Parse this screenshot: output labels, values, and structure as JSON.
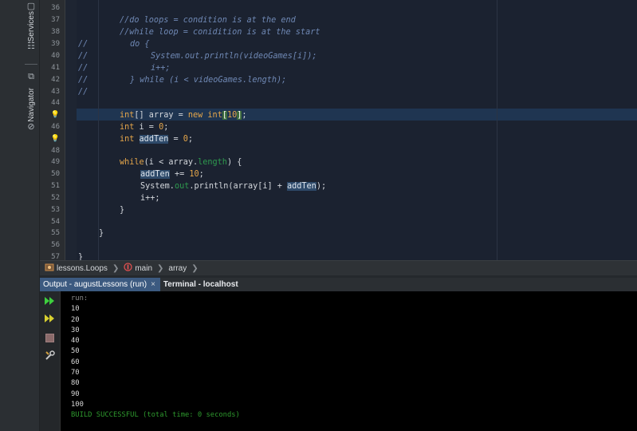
{
  "side_tabs": [
    {
      "label": "Services",
      "icon": "services-icon"
    },
    {
      "label": "Navigator",
      "icon": "navigator-icon"
    }
  ],
  "editor": {
    "line_numbers": [
      "36",
      "37",
      "38",
      "39",
      "40",
      "41",
      "42",
      "43",
      "44",
      "45",
      "46",
      "47",
      "48",
      "49",
      "50",
      "51",
      "52",
      "53",
      "54",
      "55",
      "56",
      "57"
    ],
    "lines": {
      "l37": "//do loops = condition is at the end",
      "l38": "//while loop = conidition is at the start",
      "l39_a": "//",
      "l39_b": "do {",
      "l40_a": "//",
      "l40_b": "System.out.println(videoGames[i]);",
      "l41_a": "//",
      "l41_b": "i++;",
      "l42_a": "//",
      "l42_b": "} while (i < videoGames.length);",
      "l43": "//",
      "l45_type": "int",
      "l45_a": "[] array = ",
      "l45_new": "new",
      "l45_b": " ",
      "l45_int": "int",
      "l45_lb": "[",
      "l45_num": "10",
      "l45_rb": "]",
      "l45_end": ";",
      "l46_type": "int",
      "l46_a": " i = ",
      "l46_num": "0",
      "l46_end": ";",
      "l47_type": "int",
      "l47_sp": " ",
      "l47_var": "addTen",
      "l47_a": " = ",
      "l47_num": "0",
      "l47_end": ";",
      "l49_kw": "while",
      "l49_a": "(i < array.",
      "l49_fld": "length",
      "l49_b": ") {",
      "l50_var": "addTen",
      "l50_a": " += ",
      "l50_num": "10",
      "l50_end": ";",
      "l51_a": "System.",
      "l51_fld": "out",
      "l51_b": ".println(array[i] + ",
      "l51_var": "addTen",
      "l51_end": ");",
      "l52": "i++;",
      "l53": "}",
      "l55": "}",
      "l57": "}"
    }
  },
  "breadcrumb": {
    "items": [
      "lessons.Loops",
      "main",
      "array"
    ]
  },
  "output_tabs": [
    {
      "label": "Output - augustLessons (run)",
      "close": "×"
    },
    {
      "label": "Terminal - localhost"
    }
  ],
  "console": {
    "run": "run:",
    "values": [
      "10",
      "20",
      "30",
      "40",
      "50",
      "60",
      "70",
      "80",
      "90",
      "100"
    ],
    "build": "BUILD SUCCESSFUL (total time: 0 seconds)"
  },
  "colors": {
    "editor_bg": "#1b2230",
    "comment": "#6f88b4",
    "keyword": "#e5a64a",
    "field": "#2e9a4e",
    "success": "#2e9a2e"
  }
}
